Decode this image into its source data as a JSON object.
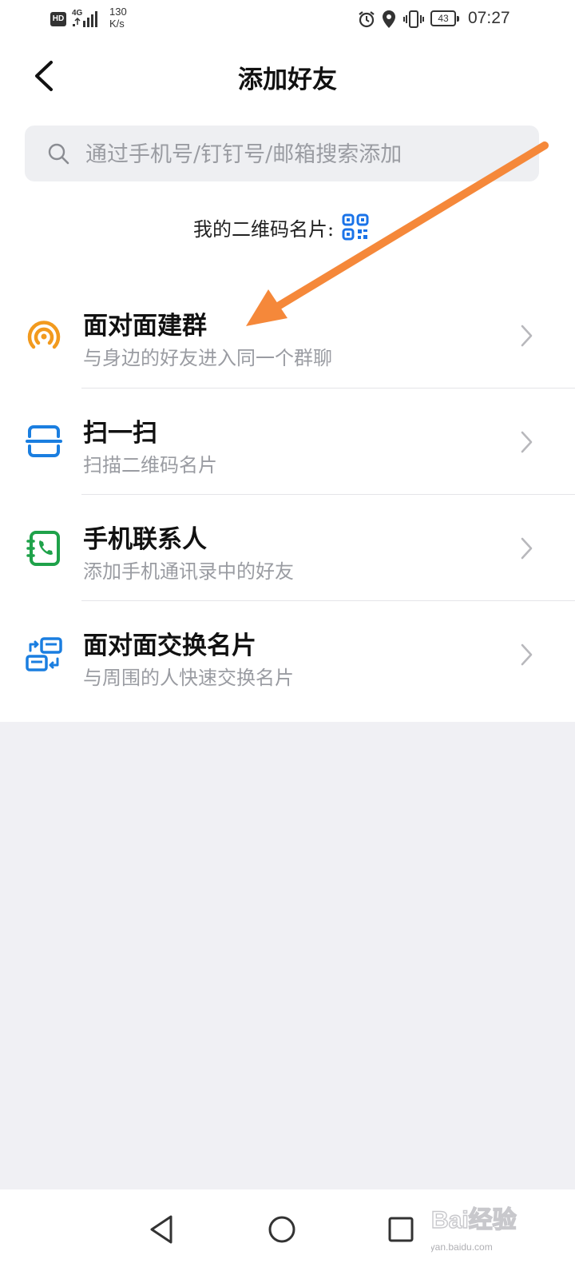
{
  "status_bar": {
    "hd": "HD",
    "network": "4G",
    "speed_value": "130",
    "speed_unit": "K/s",
    "battery": "43",
    "time": "07:27"
  },
  "header": {
    "back_icon": "chevron-left-icon",
    "title": "添加好友"
  },
  "search": {
    "icon": "search-icon",
    "placeholder": "通过手机号/钉钉号/邮箱搜索添加"
  },
  "qr": {
    "label": "我的二维码名片:",
    "icon": "qr-code-icon",
    "color": "#1a73e8"
  },
  "items": [
    {
      "title": "面对面建群",
      "subtitle": "与身边的好友进入同一个群聊",
      "icon": "broadcast-icon",
      "color": "#f29a1e"
    },
    {
      "title": "扫一扫",
      "subtitle": "扫描二维码名片",
      "icon": "scan-icon",
      "color": "#1a7ee0"
    },
    {
      "title": "手机联系人",
      "subtitle": "添加手机通讯录中的好友",
      "icon": "phone-contacts-icon",
      "color": "#1fa24a"
    },
    {
      "title": "面对面交换名片",
      "subtitle": "与周围的人快速交换名片",
      "icon": "exchange-card-icon",
      "color": "#1a7ee0"
    }
  ],
  "annotation": {
    "color": "#f5883a"
  },
  "nav": {
    "back": "triangle-back-icon",
    "home": "circle-home-icon",
    "recent": "square-recents-icon"
  },
  "watermark": {
    "text": "Bai经验",
    "url_text": "jingyan.baidu.com"
  }
}
